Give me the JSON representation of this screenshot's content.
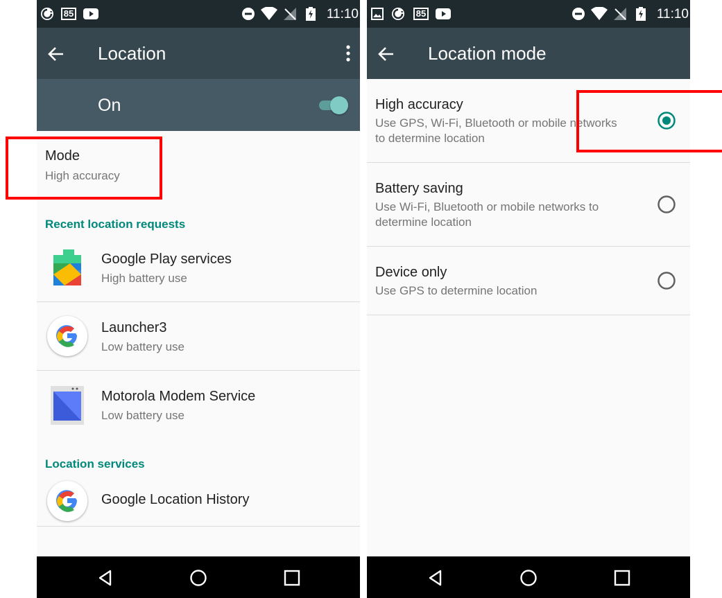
{
  "status_bar": {
    "badge": "85",
    "time": "11:10"
  },
  "left": {
    "title": "Location",
    "switch_label": "On",
    "switch_on": true,
    "mode": {
      "title": "Mode",
      "value": "High accuracy"
    },
    "recent_header": "Recent location requests",
    "recent_requests": [
      {
        "name": "Google Play services",
        "usage": "High battery use",
        "icon": "google-play-services-icon"
      },
      {
        "name": "Launcher3",
        "usage": "Low battery use",
        "icon": "google-g-icon"
      },
      {
        "name": "Motorola Modem Service",
        "usage": "Low battery use",
        "icon": "modem-service-icon"
      }
    ],
    "services_header": "Location services",
    "services": [
      {
        "name": "Google Location History",
        "icon": "google-g-icon"
      }
    ]
  },
  "right": {
    "title": "Location mode",
    "options": [
      {
        "title": "High accuracy",
        "description": "Use GPS, Wi-Fi, Bluetooth or mobile networks to determine location",
        "desc_lines": [
          "Use GPS, Wi-Fi, Bluetooth or mobile networks",
          "to determine location"
        ],
        "selected": true
      },
      {
        "title": "Battery saving",
        "description": "Use Wi-Fi, Bluetooth or mobile networks to determine location",
        "desc_lines": [
          "Use Wi-Fi, Bluetooth or mobile networks to",
          "determine location"
        ],
        "selected": false
      },
      {
        "title": "Device only",
        "description": "Use GPS to determine location",
        "desc_lines": [
          "Use GPS to determine location"
        ],
        "selected": false
      }
    ]
  },
  "colors": {
    "accent": "#00897b",
    "appbar": "#37474f",
    "switchbar": "#455a64",
    "statusbar": "#1f2a2f",
    "highlight": "#ff0000"
  }
}
